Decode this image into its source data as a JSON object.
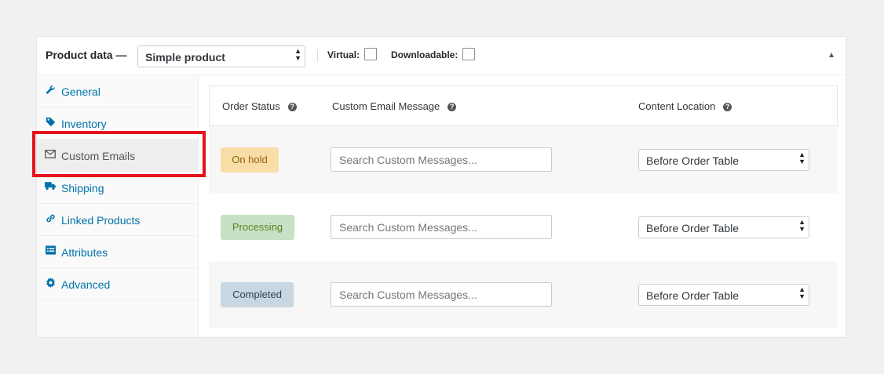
{
  "header": {
    "title": "Product data —",
    "product_type": "Simple product",
    "virtual_label": "Virtual:",
    "downloadable_label": "Downloadable:"
  },
  "sidebar": {
    "items": [
      {
        "label": "General",
        "icon": "wrench-icon"
      },
      {
        "label": "Inventory",
        "icon": "tag-icon"
      },
      {
        "label": "Custom Emails",
        "icon": "envelope-icon"
      },
      {
        "label": "Shipping",
        "icon": "truck-icon"
      },
      {
        "label": "Linked Products",
        "icon": "link-icon"
      },
      {
        "label": "Attributes",
        "icon": "list-icon"
      },
      {
        "label": "Advanced",
        "icon": "gear-icon"
      }
    ],
    "active_index": 2
  },
  "table": {
    "columns": [
      "Order Status",
      "Custom Email Message",
      "Content Location"
    ],
    "rows": [
      {
        "status": "On hold",
        "status_bg": "#f8dda7",
        "status_fg": "#94660c",
        "message_placeholder": "Search Custom Messages...",
        "location": "Before Order Table"
      },
      {
        "status": "Processing",
        "status_bg": "#c6e1c6",
        "status_fg": "#5b841b",
        "message_placeholder": "Search Custom Messages...",
        "location": "Before Order Table"
      },
      {
        "status": "Completed",
        "status_bg": "#c8d7e1",
        "status_fg": "#2e4453",
        "message_placeholder": "Search Custom Messages...",
        "location": "Before Order Table"
      }
    ]
  },
  "colors": {
    "link": "#0073aa",
    "highlight": "#e4121b"
  }
}
